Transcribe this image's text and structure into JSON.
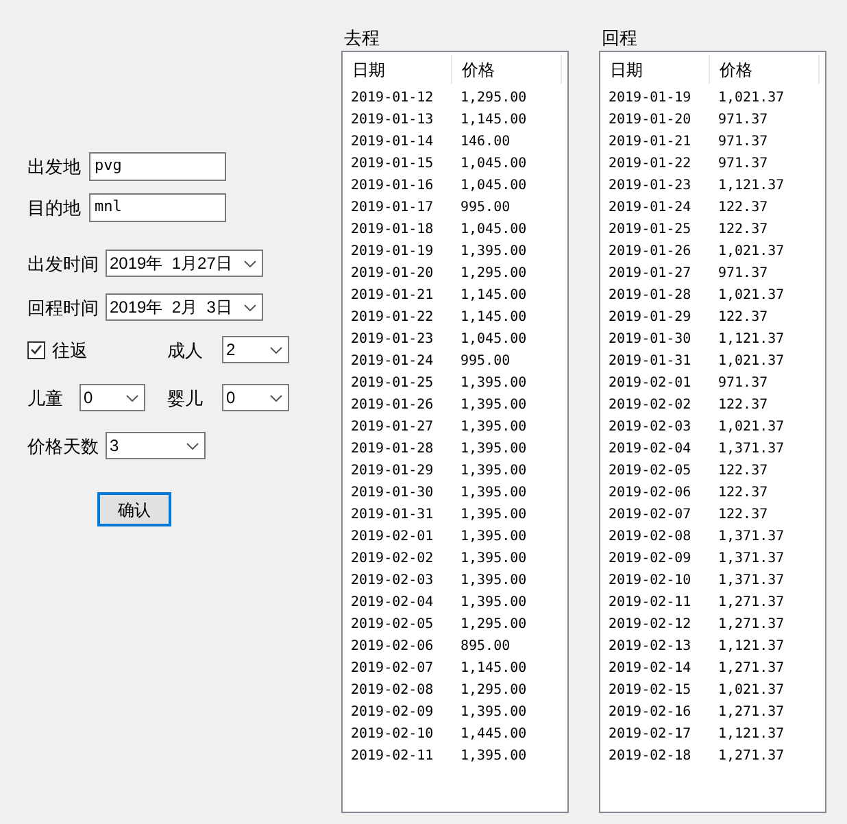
{
  "form": {
    "origin": {
      "label": "出发地",
      "value": "pvg"
    },
    "destination": {
      "label": "目的地",
      "value": "mnl"
    },
    "depart_date": {
      "label": "出发时间",
      "value": "2019年  1月27日"
    },
    "return_date": {
      "label": "回程时间",
      "value": "2019年  2月  3日"
    },
    "round_trip": {
      "label": "往返",
      "checked": true
    },
    "adults": {
      "label": "成人",
      "value": "2"
    },
    "children": {
      "label": "儿童",
      "value": "0"
    },
    "infants": {
      "label": "婴儿",
      "value": "0"
    },
    "price_days": {
      "label": "价格天数",
      "value": "3"
    },
    "confirm_button": "确认"
  },
  "lists": [
    {
      "title": "去程",
      "columns": [
        "日期",
        "价格"
      ],
      "rows": [
        [
          "2019-01-12",
          "1,295.00"
        ],
        [
          "2019-01-13",
          "1,145.00"
        ],
        [
          "2019-01-14",
          "146.00"
        ],
        [
          "2019-01-15",
          "1,045.00"
        ],
        [
          "2019-01-16",
          "1,045.00"
        ],
        [
          "2019-01-17",
          "995.00"
        ],
        [
          "2019-01-18",
          "1,045.00"
        ],
        [
          "2019-01-19",
          "1,395.00"
        ],
        [
          "2019-01-20",
          "1,295.00"
        ],
        [
          "2019-01-21",
          "1,145.00"
        ],
        [
          "2019-01-22",
          "1,145.00"
        ],
        [
          "2019-01-23",
          "1,045.00"
        ],
        [
          "2019-01-24",
          "995.00"
        ],
        [
          "2019-01-25",
          "1,395.00"
        ],
        [
          "2019-01-26",
          "1,395.00"
        ],
        [
          "2019-01-27",
          "1,395.00"
        ],
        [
          "2019-01-28",
          "1,395.00"
        ],
        [
          "2019-01-29",
          "1,395.00"
        ],
        [
          "2019-01-30",
          "1,395.00"
        ],
        [
          "2019-01-31",
          "1,395.00"
        ],
        [
          "2019-02-01",
          "1,395.00"
        ],
        [
          "2019-02-02",
          "1,395.00"
        ],
        [
          "2019-02-03",
          "1,395.00"
        ],
        [
          "2019-02-04",
          "1,395.00"
        ],
        [
          "2019-02-05",
          "1,295.00"
        ],
        [
          "2019-02-06",
          "895.00"
        ],
        [
          "2019-02-07",
          "1,145.00"
        ],
        [
          "2019-02-08",
          "1,295.00"
        ],
        [
          "2019-02-09",
          "1,395.00"
        ],
        [
          "2019-02-10",
          "1,445.00"
        ],
        [
          "2019-02-11",
          "1,395.00"
        ]
      ]
    },
    {
      "title": "回程",
      "columns": [
        "日期",
        "价格"
      ],
      "rows": [
        [
          "2019-01-19",
          "1,021.37"
        ],
        [
          "2019-01-20",
          "971.37"
        ],
        [
          "2019-01-21",
          "971.37"
        ],
        [
          "2019-01-22",
          "971.37"
        ],
        [
          "2019-01-23",
          "1,121.37"
        ],
        [
          "2019-01-24",
          "122.37"
        ],
        [
          "2019-01-25",
          "122.37"
        ],
        [
          "2019-01-26",
          "1,021.37"
        ],
        [
          "2019-01-27",
          "971.37"
        ],
        [
          "2019-01-28",
          "1,021.37"
        ],
        [
          "2019-01-29",
          "122.37"
        ],
        [
          "2019-01-30",
          "1,121.37"
        ],
        [
          "2019-01-31",
          "1,021.37"
        ],
        [
          "2019-02-01",
          "971.37"
        ],
        [
          "2019-02-02",
          "122.37"
        ],
        [
          "2019-02-03",
          "1,021.37"
        ],
        [
          "2019-02-04",
          "1,371.37"
        ],
        [
          "2019-02-05",
          "122.37"
        ],
        [
          "2019-02-06",
          "122.37"
        ],
        [
          "2019-02-07",
          "122.37"
        ],
        [
          "2019-02-08",
          "1,371.37"
        ],
        [
          "2019-02-09",
          "1,371.37"
        ],
        [
          "2019-02-10",
          "1,371.37"
        ],
        [
          "2019-02-11",
          "1,271.37"
        ],
        [
          "2019-02-12",
          "1,271.37"
        ],
        [
          "2019-02-13",
          "1,121.37"
        ],
        [
          "2019-02-14",
          "1,271.37"
        ],
        [
          "2019-02-15",
          "1,021.37"
        ],
        [
          "2019-02-16",
          "1,271.37"
        ],
        [
          "2019-02-17",
          "1,121.37"
        ],
        [
          "2019-02-18",
          "1,271.37"
        ]
      ]
    }
  ]
}
